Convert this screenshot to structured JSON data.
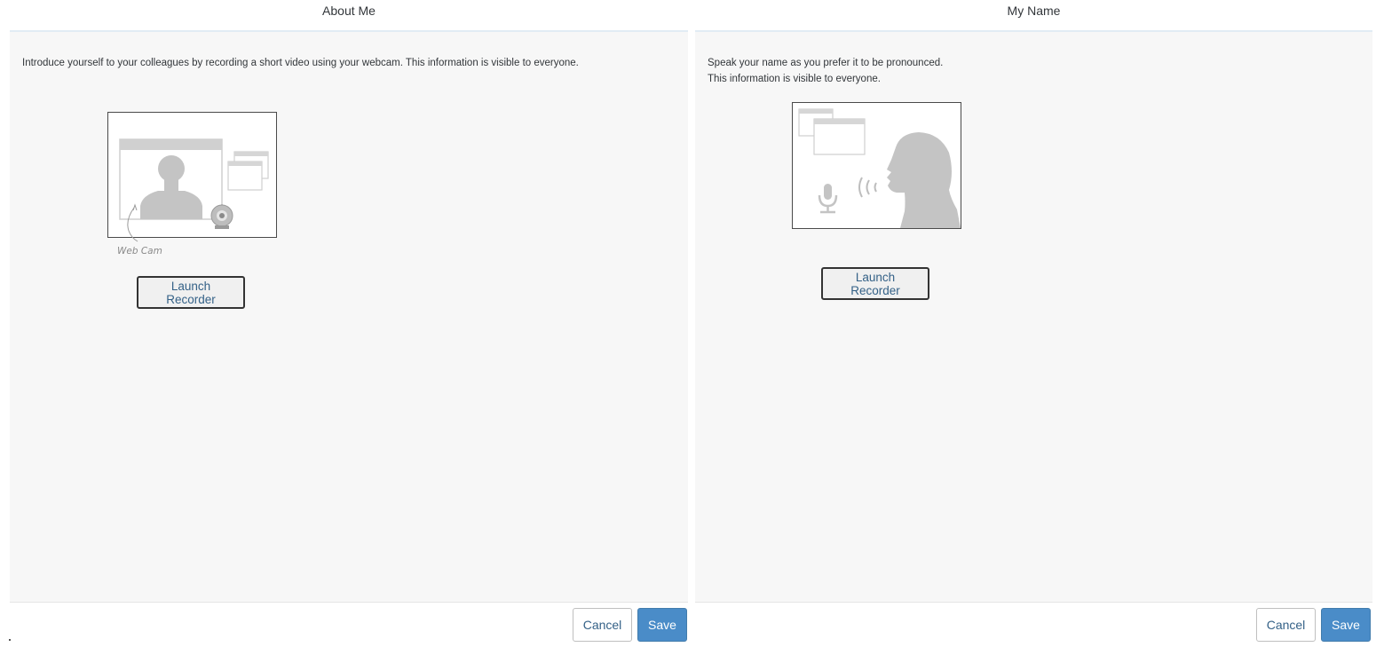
{
  "dialogs": {
    "about_me": {
      "title": "About Me",
      "description": "Introduce yourself to your colleagues by recording a short video using your webcam. This information is visible to everyone.",
      "illustration_icon": "webcam-illustration-icon",
      "illustration_caption": "Web Cam",
      "launch_label": "Launch Recorder",
      "cancel_label": "Cancel",
      "save_label": "Save"
    },
    "my_name": {
      "title": "My Name",
      "description_line1": "Speak your name as you prefer it to be pronounced.",
      "description_line2": "This information is visible to everyone.",
      "illustration_icon": "speaking-person-illustration-icon",
      "launch_label": "Launch Recorder",
      "cancel_label": "Cancel",
      "save_label": "Save"
    }
  },
  "colors": {
    "accent": "#4a8cc8",
    "link_text": "#346187",
    "body_background": "#f7f7f7",
    "header_rule": "#e2ecf4"
  }
}
